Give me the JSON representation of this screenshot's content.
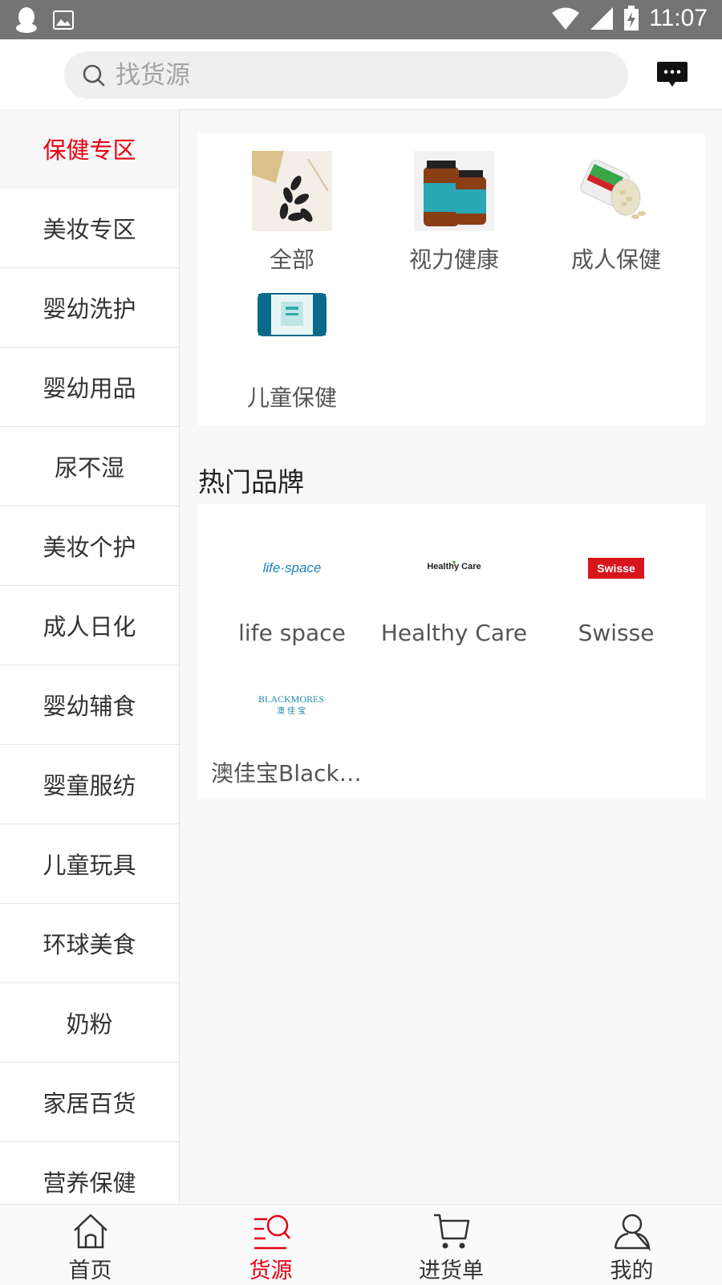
{
  "status_bar": {
    "time": "11:07"
  },
  "header": {
    "search_placeholder": "找货源",
    "message_icon": "chat-bubble-icon"
  },
  "sidebar": {
    "items": [
      {
        "label": "保健专区",
        "active": true
      },
      {
        "label": "美妆专区"
      },
      {
        "label": "婴幼洗护"
      },
      {
        "label": "婴幼用品"
      },
      {
        "label": "尿不湿"
      },
      {
        "label": "美妆个护"
      },
      {
        "label": "成人日化"
      },
      {
        "label": "婴幼辅食"
      },
      {
        "label": "婴童服纺"
      },
      {
        "label": "儿童玩具"
      },
      {
        "label": "环球美食"
      },
      {
        "label": "奶粉"
      },
      {
        "label": "家居百货"
      },
      {
        "label": "营养保健"
      }
    ]
  },
  "categories": [
    {
      "label": "全部"
    },
    {
      "label": "视力健康"
    },
    {
      "label": "成人保健"
    },
    {
      "label": "儿童保健"
    }
  ],
  "brands_section": {
    "title": "热门品牌",
    "brands": [
      {
        "label": "life space",
        "logo_text": "life·space"
      },
      {
        "label": "Healthy Care",
        "logo_text": "Healthy Care"
      },
      {
        "label": "Swisse",
        "logo_text": "Swisse"
      },
      {
        "label": "澳佳宝Blackm...",
        "logo_text": "BLACKMORES",
        "logo_subtext": "澳 佳 宝"
      }
    ]
  },
  "tabbar": {
    "tabs": [
      {
        "label": "首页",
        "icon": "home-icon"
      },
      {
        "label": "货源",
        "icon": "sourcing-search-icon",
        "active": true
      },
      {
        "label": "进货单",
        "icon": "cart-icon"
      },
      {
        "label": "我的",
        "icon": "user-icon"
      }
    ]
  },
  "colors": {
    "accent": "#e60012",
    "status_bar": "#747474",
    "background": "#f7f7f7"
  }
}
